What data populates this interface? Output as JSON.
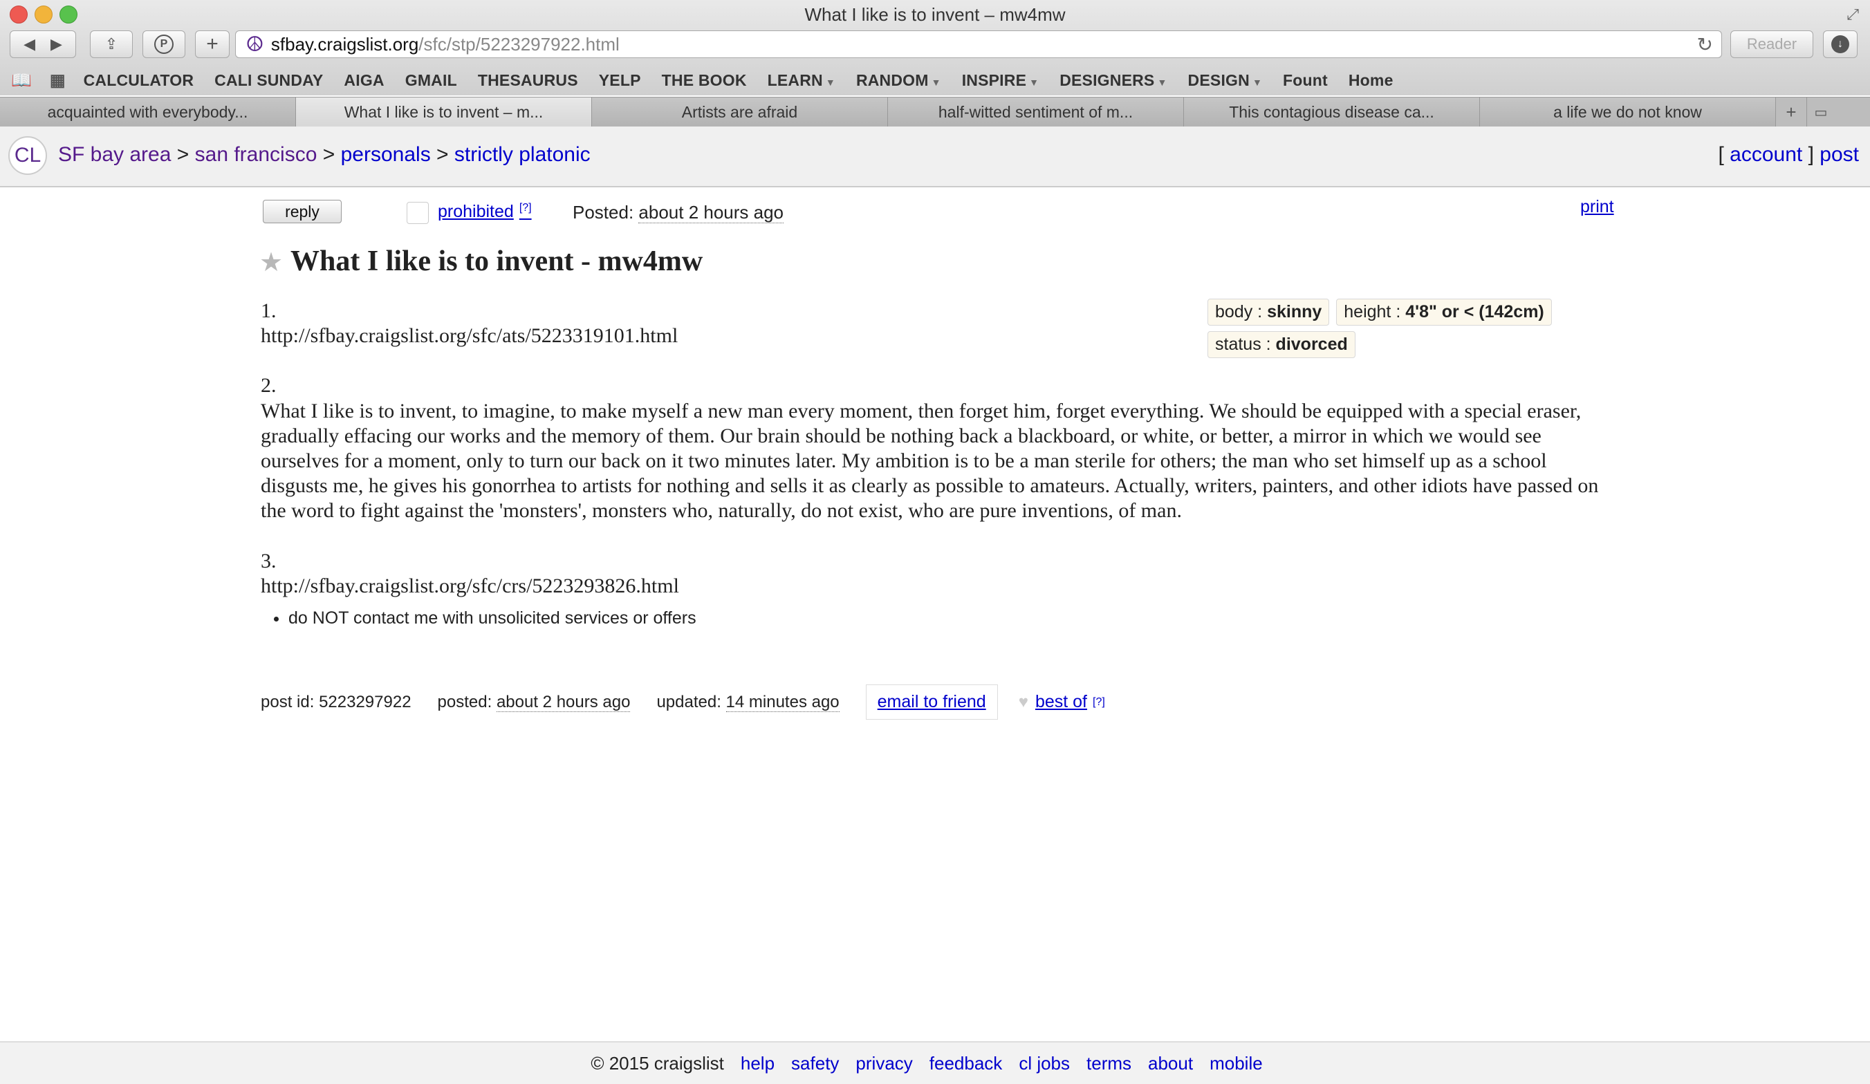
{
  "window": {
    "title": "What I like is to invent – mw4mw"
  },
  "toolbar": {
    "url_host": "sfbay.craigslist.org",
    "url_path": "/sfc/stp/5223297922.html",
    "reader_label": "Reader"
  },
  "bookmarks": [
    {
      "label": "CALCULATOR",
      "dropdown": false
    },
    {
      "label": "CALI SUNDAY",
      "dropdown": false
    },
    {
      "label": "AIGA",
      "dropdown": false
    },
    {
      "label": "GMAIL",
      "dropdown": false
    },
    {
      "label": "THESAURUS",
      "dropdown": false
    },
    {
      "label": "YELP",
      "dropdown": false
    },
    {
      "label": "THE BOOK",
      "dropdown": false
    },
    {
      "label": "LEARN",
      "dropdown": true
    },
    {
      "label": "RANDOM",
      "dropdown": true
    },
    {
      "label": "INSPIRE",
      "dropdown": true
    },
    {
      "label": "DESIGNERS",
      "dropdown": true
    },
    {
      "label": "DESIGN",
      "dropdown": true
    },
    {
      "label": "Fount",
      "dropdown": false
    },
    {
      "label": "Home",
      "dropdown": false
    }
  ],
  "tabs": [
    {
      "label": "acquainted with everybody...",
      "active": false
    },
    {
      "label": "What I like is to invent – m...",
      "active": true
    },
    {
      "label": "Artists are afraid",
      "active": false
    },
    {
      "label": "half-witted sentiment of m...",
      "active": false
    },
    {
      "label": "This contagious disease ca...",
      "active": false
    },
    {
      "label": "a life we do not know",
      "active": false
    }
  ],
  "header": {
    "logo": "CL",
    "crumbs": {
      "area": "SF bay area",
      "subarea": "san francisco",
      "category": "personals",
      "subcategory": "strictly platonic",
      "sep": ">"
    },
    "account_label": "account",
    "post_label": "post",
    "bracket_open": "[",
    "bracket_close": "]"
  },
  "posting": {
    "reply_label": "reply",
    "prohibited_label": "prohibited",
    "help_mark": "[?]",
    "posted_label": "Posted:",
    "posted_time": "about 2 hours ago",
    "print_label": "print",
    "title": "What I like is to invent - mw4mw",
    "attributes": {
      "row1": [
        {
          "key": "body : ",
          "value": "skinny"
        },
        {
          "key": "height : ",
          "value": "4'8\" or < (142cm)"
        }
      ],
      "row2": [
        {
          "key": "status : ",
          "value": "divorced"
        }
      ]
    },
    "body": {
      "item1_num": "1.",
      "item1_text": "http://sfbay.craigslist.org/sfc/ats/5223319101.html",
      "item2_num": "2.",
      "item2_text": "What I like is to invent, to imagine, to make myself a new man every moment, then forget him, forget everything. We should be equipped with a special eraser, gradually effacing our works and the memory of them. Our brain should be nothing back a blackboard, or white, or better, a mirror in which we would see ourselves for a moment, only to turn our back on it two minutes later. My ambition is to be a man sterile for others; the man who set himself up as a school disgusts me, he gives his gonorrhea to artists for nothing and sells it as clearly as possible to amateurs. Actually, writers, painters, and other idiots have passed on the word to fight against the 'monsters', monsters who, naturally, do not exist, who are pure inventions, of man.",
      "item3_num": "3.",
      "item3_text": "http://sfbay.craigslist.org/sfc/crs/5223293826.html"
    },
    "notice": "do NOT contact me with unsolicited services or offers",
    "post_id_label": "post id:",
    "post_id": "5223297922",
    "posted_label_lower": "posted:",
    "updated_label": "updated:",
    "updated_time": "14 minutes ago",
    "email_label": "email to friend",
    "best_of_label": "best of"
  },
  "footer": {
    "copyright": "© 2015 craigslist",
    "links": [
      "help",
      "safety",
      "privacy",
      "feedback",
      "cl jobs",
      "terms",
      "about",
      "mobile"
    ]
  }
}
